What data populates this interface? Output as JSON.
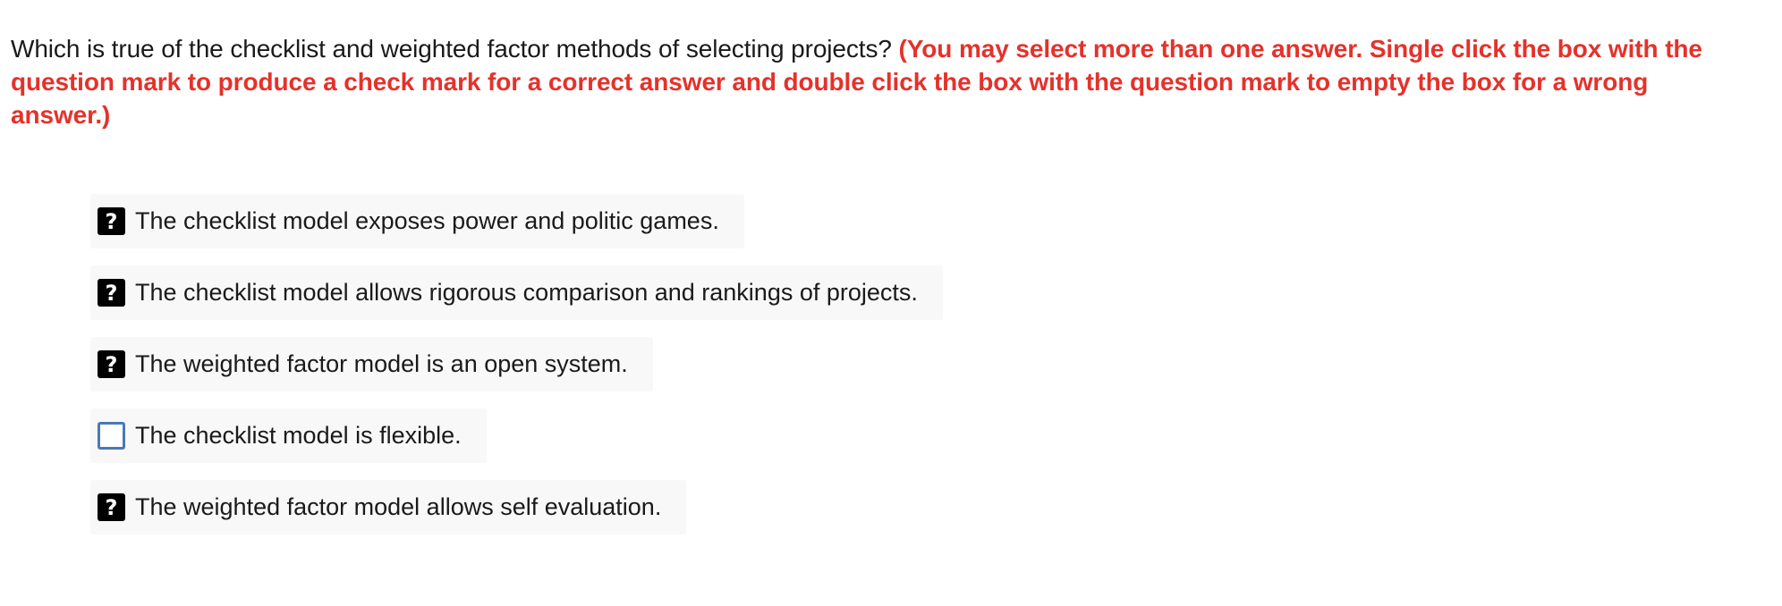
{
  "question": {
    "text": "Which is true of the checklist and weighted factor methods of selecting projects?",
    "instruction": "(You may select more than one answer. Single click the box with the question mark to produce a check mark for a correct answer and double click the box with the question mark to empty the box for a wrong answer.)"
  },
  "options": [
    {
      "label": "The checklist model exposes power and politic games.",
      "state": "unknown",
      "box_glyph": "?"
    },
    {
      "label": "The checklist model allows rigorous comparison and rankings of projects.",
      "state": "unknown",
      "box_glyph": "?"
    },
    {
      "label": "The weighted factor model is an open system.",
      "state": "unknown",
      "box_glyph": "?"
    },
    {
      "label": "The checklist model is flexible.",
      "state": "empty",
      "box_glyph": ""
    },
    {
      "label": "The weighted factor model allows self evaluation.",
      "state": "unknown",
      "box_glyph": "?"
    }
  ],
  "colors": {
    "instruction": "#e4322b",
    "unknown_box": "#000000",
    "empty_box_border": "#4a78b5",
    "option_background": "#f8f8f8"
  }
}
